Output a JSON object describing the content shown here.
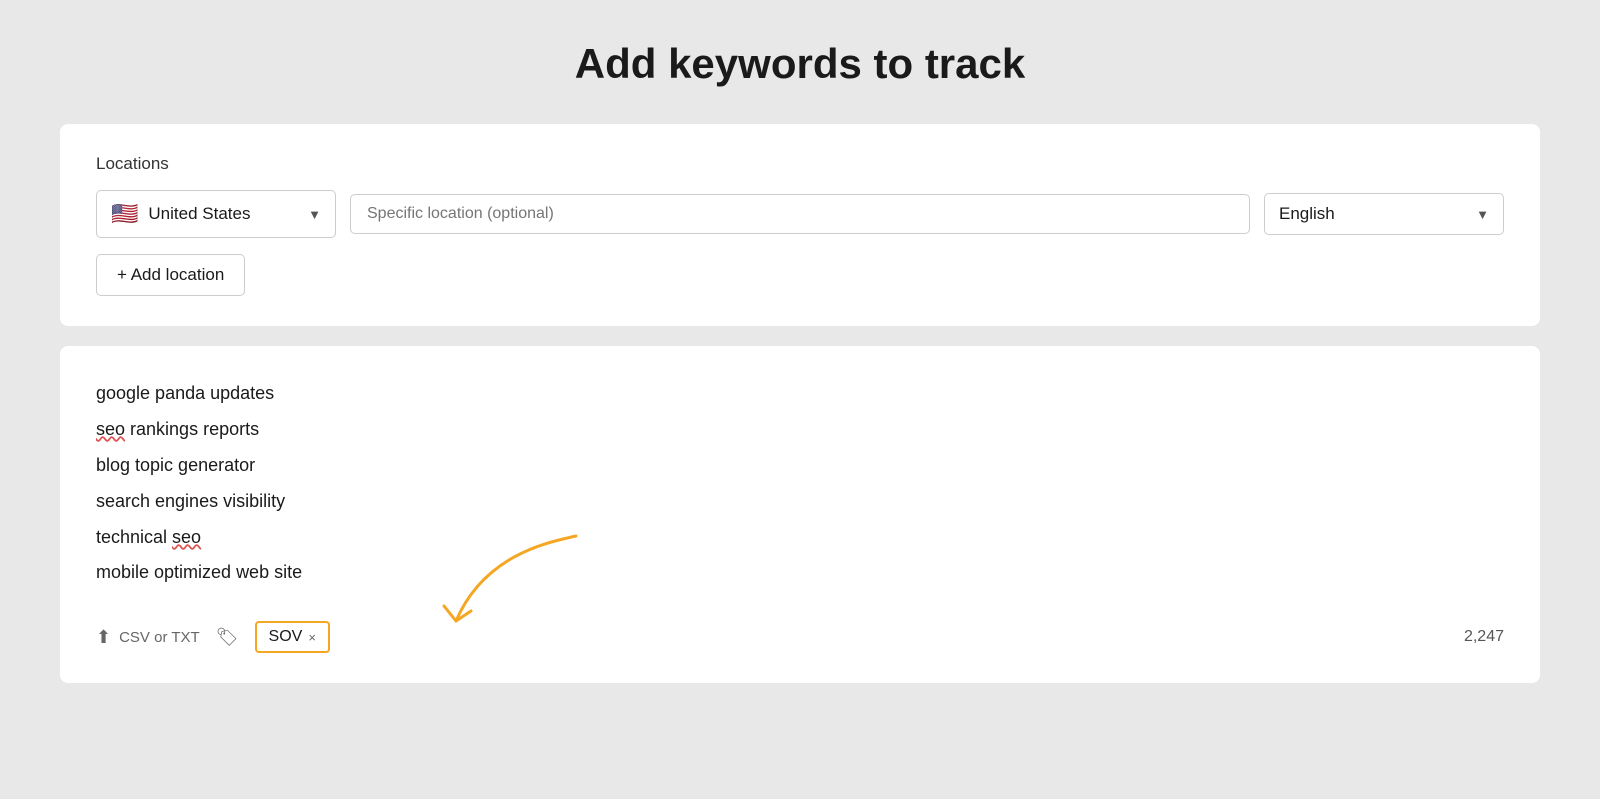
{
  "page": {
    "title": "Add keywords to track"
  },
  "locations_section": {
    "label": "Locations",
    "country": {
      "flag": "🇺🇸",
      "name": "United States"
    },
    "specific_location": {
      "placeholder": "Specific location (optional)"
    },
    "language": {
      "name": "English"
    },
    "add_location_label": "+ Add location"
  },
  "keywords_section": {
    "keywords": [
      "google panda updates",
      "seo rankings reports",
      "blog topic generator",
      "search engines visibility",
      "technical seo",
      "mobile optimized web site"
    ],
    "sov_tag_label": "SOV",
    "sov_close": "×",
    "csv_label": "CSV or TXT",
    "keyword_count": "2,247"
  }
}
